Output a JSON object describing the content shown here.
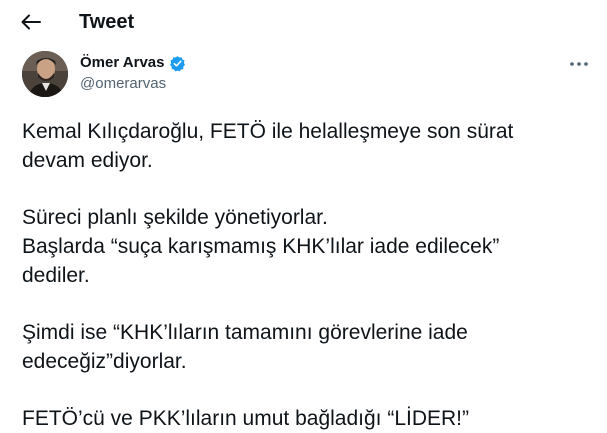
{
  "header": {
    "title": "Tweet",
    "back_icon": "arrow-left-icon"
  },
  "author": {
    "name": "Ömer Arvas",
    "handle": "@omerarvas",
    "verified": true,
    "verified_color": "#1d9bf0",
    "more_icon": "more-horizontal-icon"
  },
  "tweet": {
    "paragraphs": [
      [
        "Kemal Kılıçdaroğlu, FETÖ ile helalleşmeye son sürat",
        "devam ediyor."
      ],
      [
        "Süreci planlı şekilde yönetiyorlar.",
        "Başlarda “suça karışmamış KHK’lılar iade edilecek”",
        "dediler."
      ],
      [
        "Şimdi ise “KHK’lıların tamamını görevlerine iade",
        "edeceğiz”diyorlar."
      ],
      [
        "FETÖ’cü ve PKK’lıların umut bağladığı “LİDER!”"
      ]
    ]
  }
}
